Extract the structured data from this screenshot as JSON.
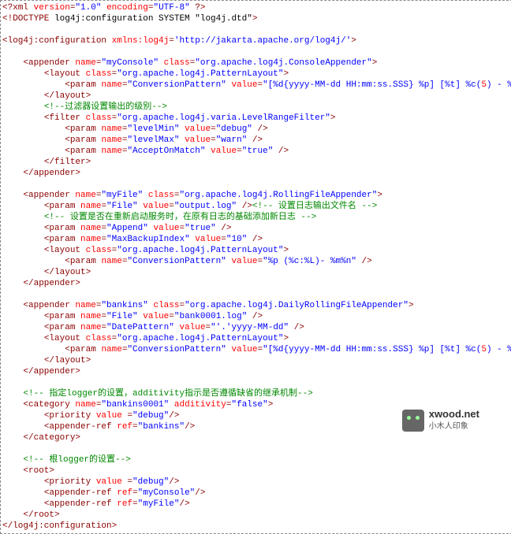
{
  "lines": [
    [
      {
        "c": "br",
        "t": "<?xml "
      },
      {
        "c": "rd",
        "t": "version"
      },
      {
        "c": "br",
        "t": "="
      },
      {
        "c": "bl",
        "t": "\"1.0\""
      },
      {
        "c": "br",
        "t": " "
      },
      {
        "c": "rd",
        "t": "encoding"
      },
      {
        "c": "br",
        "t": "="
      },
      {
        "c": "bl",
        "t": "\"UTF-8\""
      },
      {
        "c": "br",
        "t": " ?>"
      }
    ],
    [
      {
        "c": "br",
        "t": "<!DOCTYPE "
      },
      {
        "c": "t",
        "t": "log4j:configuration SYSTEM \"log4j.dtd\""
      },
      {
        "c": "br",
        "t": ">"
      }
    ],
    [
      {
        "c": "t",
        "t": ""
      }
    ],
    [
      {
        "c": "br",
        "t": "<log4j:configuration "
      },
      {
        "c": "rd",
        "t": "xmlns:log4j"
      },
      {
        "c": "br",
        "t": "="
      },
      {
        "c": "bl",
        "t": "'http://jakarta.apache.org/log4j/'"
      },
      {
        "c": "br",
        "t": ">"
      }
    ],
    [
      {
        "c": "t",
        "t": ""
      }
    ],
    [
      {
        "c": "t",
        "t": "    "
      },
      {
        "c": "br",
        "t": "<appender "
      },
      {
        "c": "rd",
        "t": "name"
      },
      {
        "c": "br",
        "t": "="
      },
      {
        "c": "bl",
        "t": "\"myConsole\""
      },
      {
        "c": "br",
        "t": " "
      },
      {
        "c": "rd",
        "t": "class"
      },
      {
        "c": "br",
        "t": "="
      },
      {
        "c": "bl",
        "t": "\"org.apache.log4j.ConsoleAppender\""
      },
      {
        "c": "br",
        "t": ">"
      }
    ],
    [
      {
        "c": "t",
        "t": "        "
      },
      {
        "c": "br",
        "t": "<layout "
      },
      {
        "c": "rd",
        "t": "class"
      },
      {
        "c": "br",
        "t": "="
      },
      {
        "c": "bl",
        "t": "\"org.apache.log4j.PatternLayout\""
      },
      {
        "c": "br",
        "t": ">"
      }
    ],
    [
      {
        "c": "t",
        "t": "            "
      },
      {
        "c": "br",
        "t": "<param "
      },
      {
        "c": "rd",
        "t": "name"
      },
      {
        "c": "br",
        "t": "="
      },
      {
        "c": "bl",
        "t": "\"ConversionPattern\""
      },
      {
        "c": "br",
        "t": " "
      },
      {
        "c": "rd",
        "t": "value"
      },
      {
        "c": "br",
        "t": "="
      },
      {
        "c": "bl",
        "t": "\"[%d{yyyy-MM-dd HH:mm:ss.SSS} %p] [%t] %c("
      },
      {
        "c": "rd",
        "t": "5"
      },
      {
        "c": "bl",
        "t": ") - %m%n\""
      },
      {
        "c": "br",
        "t": " />"
      }
    ],
    [
      {
        "c": "t",
        "t": "        "
      },
      {
        "c": "br",
        "t": "</layout>"
      }
    ],
    [
      {
        "c": "t",
        "t": "        "
      },
      {
        "c": "gr",
        "t": "<!--过滤器设置输出的级别-->"
      }
    ],
    [
      {
        "c": "t",
        "t": "        "
      },
      {
        "c": "br",
        "t": "<filter "
      },
      {
        "c": "rd",
        "t": "class"
      },
      {
        "c": "br",
        "t": "="
      },
      {
        "c": "bl",
        "t": "\"org.apache.log4j.varia.LevelRangeFilter\""
      },
      {
        "c": "br",
        "t": ">"
      }
    ],
    [
      {
        "c": "t",
        "t": "            "
      },
      {
        "c": "br",
        "t": "<param "
      },
      {
        "c": "rd",
        "t": "name"
      },
      {
        "c": "br",
        "t": "="
      },
      {
        "c": "bl",
        "t": "\"levelMin\""
      },
      {
        "c": "br",
        "t": " "
      },
      {
        "c": "rd",
        "t": "value"
      },
      {
        "c": "br",
        "t": "="
      },
      {
        "c": "bl",
        "t": "\"debug\""
      },
      {
        "c": "br",
        "t": " />"
      }
    ],
    [
      {
        "c": "t",
        "t": "            "
      },
      {
        "c": "br",
        "t": "<param "
      },
      {
        "c": "rd",
        "t": "name"
      },
      {
        "c": "br",
        "t": "="
      },
      {
        "c": "bl",
        "t": "\"levelMax\""
      },
      {
        "c": "br",
        "t": " "
      },
      {
        "c": "rd",
        "t": "value"
      },
      {
        "c": "br",
        "t": "="
      },
      {
        "c": "bl",
        "t": "\"warn\""
      },
      {
        "c": "br",
        "t": " />"
      }
    ],
    [
      {
        "c": "t",
        "t": "            "
      },
      {
        "c": "br",
        "t": "<param "
      },
      {
        "c": "rd",
        "t": "name"
      },
      {
        "c": "br",
        "t": "="
      },
      {
        "c": "bl",
        "t": "\"AcceptOnMatch\""
      },
      {
        "c": "br",
        "t": " "
      },
      {
        "c": "rd",
        "t": "value"
      },
      {
        "c": "br",
        "t": "="
      },
      {
        "c": "bl",
        "t": "\"true\""
      },
      {
        "c": "br",
        "t": " />"
      }
    ],
    [
      {
        "c": "t",
        "t": "        "
      },
      {
        "c": "br",
        "t": "</filter>"
      }
    ],
    [
      {
        "c": "t",
        "t": "    "
      },
      {
        "c": "br",
        "t": "</appender>"
      }
    ],
    [
      {
        "c": "t",
        "t": ""
      }
    ],
    [
      {
        "c": "t",
        "t": "    "
      },
      {
        "c": "br",
        "t": "<appender "
      },
      {
        "c": "rd",
        "t": "name"
      },
      {
        "c": "br",
        "t": "="
      },
      {
        "c": "bl",
        "t": "\"myFile\""
      },
      {
        "c": "br",
        "t": " "
      },
      {
        "c": "rd",
        "t": "class"
      },
      {
        "c": "br",
        "t": "="
      },
      {
        "c": "bl",
        "t": "\"org.apache.log4j.RollingFileAppender\""
      },
      {
        "c": "br",
        "t": ">"
      }
    ],
    [
      {
        "c": "t",
        "t": "        "
      },
      {
        "c": "br",
        "t": "<param "
      },
      {
        "c": "rd",
        "t": "name"
      },
      {
        "c": "br",
        "t": "="
      },
      {
        "c": "bl",
        "t": "\"File\""
      },
      {
        "c": "br",
        "t": " "
      },
      {
        "c": "rd",
        "t": "value"
      },
      {
        "c": "br",
        "t": "="
      },
      {
        "c": "bl",
        "t": "\"output.log\""
      },
      {
        "c": "br",
        "t": " />"
      },
      {
        "c": "gr",
        "t": "<!-- 设置日志输出文件名 -->"
      }
    ],
    [
      {
        "c": "t",
        "t": "        "
      },
      {
        "c": "gr",
        "t": "<!-- 设置是否在重新启动服务时，在原有日志的基础添加新日志 -->"
      }
    ],
    [
      {
        "c": "t",
        "t": "        "
      },
      {
        "c": "br",
        "t": "<param "
      },
      {
        "c": "rd",
        "t": "name"
      },
      {
        "c": "br",
        "t": "="
      },
      {
        "c": "bl",
        "t": "\"Append\""
      },
      {
        "c": "br",
        "t": " "
      },
      {
        "c": "rd",
        "t": "value"
      },
      {
        "c": "br",
        "t": "="
      },
      {
        "c": "bl",
        "t": "\"true\""
      },
      {
        "c": "br",
        "t": " />"
      }
    ],
    [
      {
        "c": "t",
        "t": "        "
      },
      {
        "c": "br",
        "t": "<param "
      },
      {
        "c": "rd",
        "t": "name"
      },
      {
        "c": "br",
        "t": "="
      },
      {
        "c": "bl",
        "t": "\"MaxBackupIndex\""
      },
      {
        "c": "br",
        "t": " "
      },
      {
        "c": "rd",
        "t": "value"
      },
      {
        "c": "br",
        "t": "="
      },
      {
        "c": "bl",
        "t": "\"10\""
      },
      {
        "c": "br",
        "t": " />"
      }
    ],
    [
      {
        "c": "t",
        "t": "        "
      },
      {
        "c": "br",
        "t": "<layout "
      },
      {
        "c": "rd",
        "t": "class"
      },
      {
        "c": "br",
        "t": "="
      },
      {
        "c": "bl",
        "t": "\"org.apache.log4j.PatternLayout\""
      },
      {
        "c": "br",
        "t": ">"
      }
    ],
    [
      {
        "c": "t",
        "t": "            "
      },
      {
        "c": "br",
        "t": "<param "
      },
      {
        "c": "rd",
        "t": "name"
      },
      {
        "c": "br",
        "t": "="
      },
      {
        "c": "bl",
        "t": "\"ConversionPattern\""
      },
      {
        "c": "br",
        "t": " "
      },
      {
        "c": "rd",
        "t": "value"
      },
      {
        "c": "br",
        "t": "="
      },
      {
        "c": "bl",
        "t": "\"%p (%c:%L)- %m%n\""
      },
      {
        "c": "br",
        "t": " />"
      }
    ],
    [
      {
        "c": "t",
        "t": "        "
      },
      {
        "c": "br",
        "t": "</layout>"
      }
    ],
    [
      {
        "c": "t",
        "t": "    "
      },
      {
        "c": "br",
        "t": "</appender>"
      }
    ],
    [
      {
        "c": "t",
        "t": ""
      }
    ],
    [
      {
        "c": "t",
        "t": "    "
      },
      {
        "c": "br",
        "t": "<appender "
      },
      {
        "c": "rd",
        "t": "name"
      },
      {
        "c": "br",
        "t": "="
      },
      {
        "c": "bl",
        "t": "\"bankins\""
      },
      {
        "c": "br",
        "t": " "
      },
      {
        "c": "rd",
        "t": "class"
      },
      {
        "c": "br",
        "t": "="
      },
      {
        "c": "bl",
        "t": "\"org.apache.log4j.DailyRollingFileAppender\""
      },
      {
        "c": "br",
        "t": ">"
      }
    ],
    [
      {
        "c": "t",
        "t": "        "
      },
      {
        "c": "br",
        "t": "<param "
      },
      {
        "c": "rd",
        "t": "name"
      },
      {
        "c": "br",
        "t": "="
      },
      {
        "c": "bl",
        "t": "\"File\""
      },
      {
        "c": "br",
        "t": " "
      },
      {
        "c": "rd",
        "t": "value"
      },
      {
        "c": "br",
        "t": "="
      },
      {
        "c": "bl",
        "t": "\"bank0001.log\""
      },
      {
        "c": "br",
        "t": " />"
      }
    ],
    [
      {
        "c": "t",
        "t": "        "
      },
      {
        "c": "br",
        "t": "<param "
      },
      {
        "c": "rd",
        "t": "name"
      },
      {
        "c": "br",
        "t": "="
      },
      {
        "c": "bl",
        "t": "\"DatePattern\""
      },
      {
        "c": "br",
        "t": " "
      },
      {
        "c": "rd",
        "t": "value"
      },
      {
        "c": "br",
        "t": "="
      },
      {
        "c": "bl",
        "t": "\"'.'yyyy-MM-dd\""
      },
      {
        "c": "br",
        "t": " />"
      }
    ],
    [
      {
        "c": "t",
        "t": "        "
      },
      {
        "c": "br",
        "t": "<layout "
      },
      {
        "c": "rd",
        "t": "class"
      },
      {
        "c": "br",
        "t": "="
      },
      {
        "c": "bl",
        "t": "\"org.apache.log4j.PatternLayout\""
      },
      {
        "c": "br",
        "t": ">"
      }
    ],
    [
      {
        "c": "t",
        "t": "            "
      },
      {
        "c": "br",
        "t": "<param "
      },
      {
        "c": "rd",
        "t": "name"
      },
      {
        "c": "br",
        "t": "="
      },
      {
        "c": "bl",
        "t": "\"ConversionPattern\""
      },
      {
        "c": "br",
        "t": " "
      },
      {
        "c": "rd",
        "t": "value"
      },
      {
        "c": "br",
        "t": "="
      },
      {
        "c": "bl",
        "t": "\"[%d{yyyy-MM-dd HH:mm:ss.SSS} %p] [%t] %c("
      },
      {
        "c": "rd",
        "t": "5"
      },
      {
        "c": "bl",
        "t": ") - %m%n\""
      },
      {
        "c": "br",
        "t": " />"
      }
    ],
    [
      {
        "c": "t",
        "t": "        "
      },
      {
        "c": "br",
        "t": "</layout>"
      }
    ],
    [
      {
        "c": "t",
        "t": "    "
      },
      {
        "c": "br",
        "t": "</appender>"
      }
    ],
    [
      {
        "c": "t",
        "t": ""
      }
    ],
    [
      {
        "c": "t",
        "t": "    "
      },
      {
        "c": "gr",
        "t": "<!-- 指定logger的设置，additivity指示是否遵循缺省的继承机制-->"
      }
    ],
    [
      {
        "c": "t",
        "t": "    "
      },
      {
        "c": "br",
        "t": "<category "
      },
      {
        "c": "rd",
        "t": "name"
      },
      {
        "c": "br",
        "t": "="
      },
      {
        "c": "bl",
        "t": "\"bankins0001\""
      },
      {
        "c": "br",
        "t": " "
      },
      {
        "c": "rd",
        "t": "additivity"
      },
      {
        "c": "br",
        "t": "="
      },
      {
        "c": "bl",
        "t": "\"false\""
      },
      {
        "c": "br",
        "t": ">"
      }
    ],
    [
      {
        "c": "t",
        "t": "        "
      },
      {
        "c": "br",
        "t": "<priority "
      },
      {
        "c": "rd",
        "t": "value"
      },
      {
        "c": "br",
        "t": " ="
      },
      {
        "c": "bl",
        "t": "\"debug\""
      },
      {
        "c": "br",
        "t": "/>"
      }
    ],
    [
      {
        "c": "t",
        "t": "        "
      },
      {
        "c": "br",
        "t": "<appender-ref "
      },
      {
        "c": "rd",
        "t": "ref"
      },
      {
        "c": "br",
        "t": "="
      },
      {
        "c": "bl",
        "t": "\"bankins\""
      },
      {
        "c": "br",
        "t": "/>"
      }
    ],
    [
      {
        "c": "t",
        "t": "    "
      },
      {
        "c": "br",
        "t": "</category>"
      }
    ],
    [
      {
        "c": "t",
        "t": ""
      }
    ],
    [
      {
        "c": "t",
        "t": "    "
      },
      {
        "c": "gr",
        "t": "<!-- 根logger的设置-->"
      }
    ],
    [
      {
        "c": "t",
        "t": "    "
      },
      {
        "c": "br",
        "t": "<root>"
      }
    ],
    [
      {
        "c": "t",
        "t": "        "
      },
      {
        "c": "br",
        "t": "<priority "
      },
      {
        "c": "rd",
        "t": "value"
      },
      {
        "c": "br",
        "t": " ="
      },
      {
        "c": "bl",
        "t": "\"debug\""
      },
      {
        "c": "br",
        "t": "/>"
      }
    ],
    [
      {
        "c": "t",
        "t": "        "
      },
      {
        "c": "br",
        "t": "<appender-ref "
      },
      {
        "c": "rd",
        "t": "ref"
      },
      {
        "c": "br",
        "t": "="
      },
      {
        "c": "bl",
        "t": "\"myConsole\""
      },
      {
        "c": "br",
        "t": "/>"
      }
    ],
    [
      {
        "c": "t",
        "t": "        "
      },
      {
        "c": "br",
        "t": "<appender-ref "
      },
      {
        "c": "rd",
        "t": "ref"
      },
      {
        "c": "br",
        "t": "="
      },
      {
        "c": "bl",
        "t": "\"myFile\""
      },
      {
        "c": "br",
        "t": "/>"
      }
    ],
    [
      {
        "c": "t",
        "t": "    "
      },
      {
        "c": "br",
        "t": "</root>"
      }
    ],
    [
      {
        "c": "br",
        "t": "</log4j:configuration>"
      }
    ]
  ],
  "logo": {
    "title": "xwood.net",
    "sub": "小木人印象"
  }
}
